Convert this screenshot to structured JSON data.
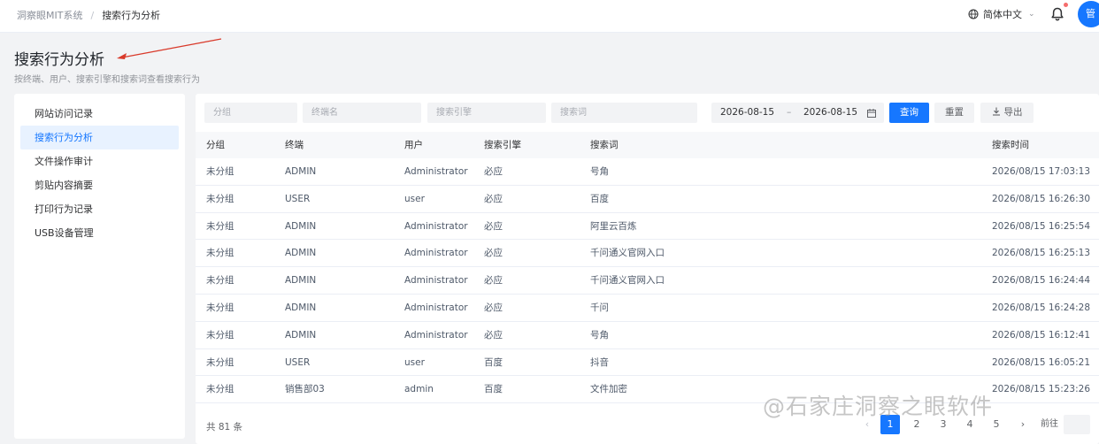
{
  "header": {
    "breadcrumb_root": "洞察眼MIT系统",
    "breadcrumb_sep": "/",
    "breadcrumb_current": "搜索行为分析",
    "language": "简体中文",
    "avatar_text": "管",
    "icons": {
      "language": "globe-icon",
      "notifications": "bell-icon"
    },
    "notification_dot_color": "#f56c6c"
  },
  "page": {
    "title": "搜索行为分析",
    "subtitle": "按终端、用户、搜索引擎和搜索词查看搜索行为"
  },
  "sidebar": {
    "items": [
      {
        "label": "网站访问记录",
        "active": false
      },
      {
        "label": "搜索行为分析",
        "active": true
      },
      {
        "label": "文件操作审计",
        "active": false
      },
      {
        "label": "剪贴内容摘要",
        "active": false
      },
      {
        "label": "打印行为记录",
        "active": false
      },
      {
        "label": "USB设备管理",
        "active": false
      }
    ]
  },
  "filters": {
    "group_placeholder": "分组",
    "terminal_placeholder": "终端名",
    "engine_placeholder": "搜索引擎",
    "keyword_placeholder": "搜索词",
    "date_start": "2026-08-15",
    "date_sep": "–",
    "date_end": "2026-08-15",
    "query_label": "查询",
    "reset_label": "重置",
    "export_label": "导出",
    "accent_color": "#1677ff"
  },
  "table": {
    "columns": [
      "分组",
      "终端",
      "用户",
      "搜索引擎",
      "搜索词",
      "搜索时间"
    ],
    "rows": [
      [
        "未分组",
        "ADMIN",
        "Administrator",
        "必应",
        "号角",
        "2026/08/15 17:03:13"
      ],
      [
        "未分组",
        "USER",
        "user",
        "必应",
        "百度",
        "2026/08/15 16:26:30"
      ],
      [
        "未分组",
        "ADMIN",
        "Administrator",
        "必应",
        "阿里云百炼",
        "2026/08/15 16:25:54"
      ],
      [
        "未分组",
        "ADMIN",
        "Administrator",
        "必应",
        "千问通义官网入口",
        "2026/08/15 16:25:13"
      ],
      [
        "未分组",
        "ADMIN",
        "Administrator",
        "必应",
        "千问通义官网入口",
        "2026/08/15 16:24:44"
      ],
      [
        "未分组",
        "ADMIN",
        "Administrator",
        "必应",
        "千问",
        "2026/08/15 16:24:28"
      ],
      [
        "未分组",
        "ADMIN",
        "Administrator",
        "必应",
        "号角",
        "2026/08/15 16:12:41"
      ],
      [
        "未分组",
        "USER",
        "user",
        "百度",
        "抖音",
        "2026/08/15 16:05:21"
      ],
      [
        "未分组",
        "销售部03",
        "admin",
        "百度",
        "文件加密",
        "2026/08/15 15:23:26"
      ]
    ]
  },
  "footer": {
    "total": "共 81 条",
    "pages": [
      "1",
      "2",
      "3",
      "4",
      "5"
    ],
    "current_page": "1",
    "goto_label": "前往",
    "prev_icon": "‹",
    "next_icon": "›"
  },
  "watermark": "@石家庄洞察之眼软件"
}
